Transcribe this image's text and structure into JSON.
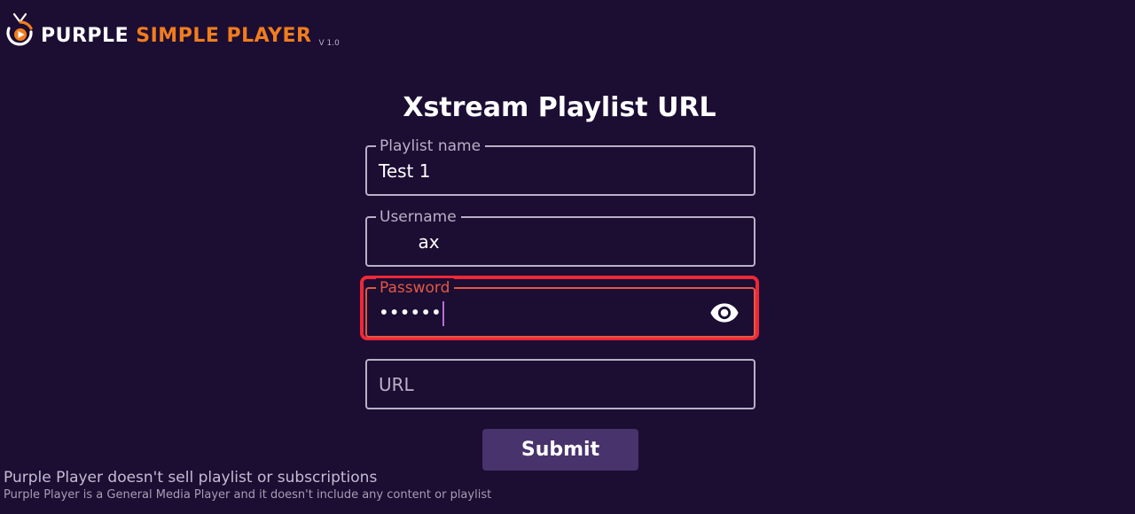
{
  "brand": {
    "logo_icon": "play-tv-icon",
    "name_part1": "PURPLE",
    "name_part2": "SIMPLE PLAYER",
    "version": "V 1.0",
    "accent_color": "#f07d1e"
  },
  "form": {
    "title": "Xstream Playlist URL",
    "playlist_name": {
      "label": "Playlist name",
      "value": "Test 1"
    },
    "username": {
      "label": "Username",
      "value": "       ax"
    },
    "password": {
      "label": "Password",
      "value": "••••••",
      "focused": true,
      "toggle_icon": "eye-icon"
    },
    "url": {
      "placeholder": "URL"
    },
    "submit_label": "Submit"
  },
  "footer": {
    "line1": "Purple Player doesn't sell playlist or subscriptions",
    "line2": "Purple Player is a General Media Player and it doesn't include any content or playlist"
  },
  "colors": {
    "background": "#1c0d33",
    "field_border": "#b8b1c6",
    "focus": "#e25846",
    "highlight": "#ee2838",
    "button": "#48336c"
  }
}
